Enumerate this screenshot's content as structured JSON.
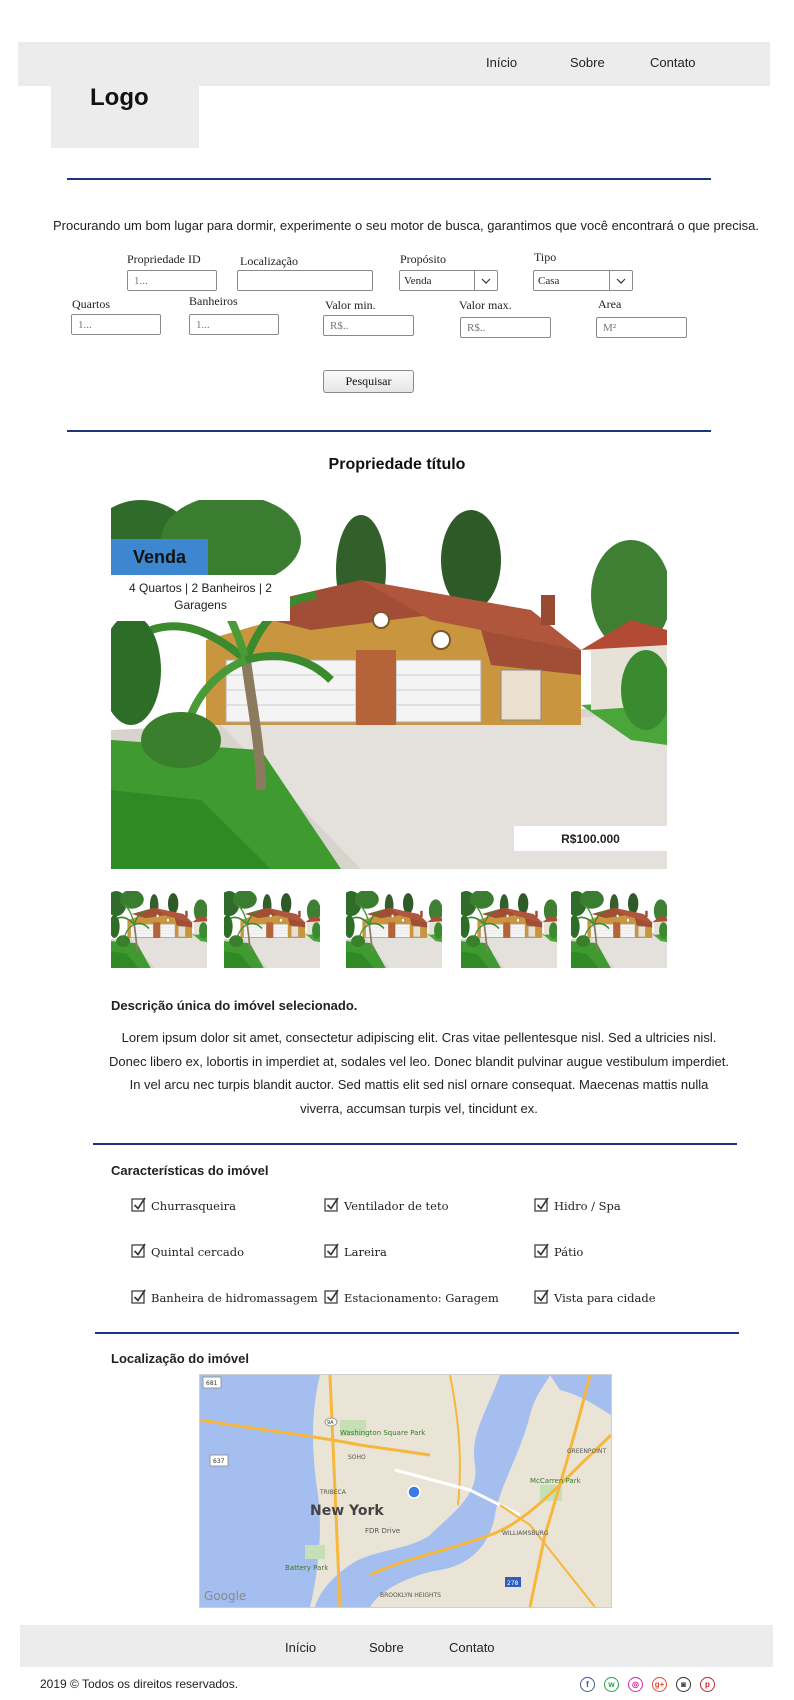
{
  "nav": {
    "items": [
      "Início",
      "Sobre",
      "Contato"
    ]
  },
  "logo": {
    "text": "Logo"
  },
  "search": {
    "intro": "Procurando um bom lugar para dormir, experimente o seu motor de busca, garantimos que você encontrará o que precisa.",
    "fields": {
      "property_id": {
        "label": "Propriedade ID",
        "placeholder": "1..."
      },
      "location": {
        "label": "Localização",
        "placeholder": ""
      },
      "purpose": {
        "label": "Propósito",
        "value": "Venda"
      },
      "type": {
        "label": "Tipo",
        "value": "Casa"
      },
      "rooms": {
        "label": "Quartos",
        "placeholder": "1..."
      },
      "bathrooms": {
        "label": "Banheiros",
        "placeholder": "1..."
      },
      "min_value": {
        "label": "Valor min.",
        "placeholder": "R$.."
      },
      "max_value": {
        "label": "Valor max.",
        "placeholder": "R$.."
      },
      "area": {
        "label": "Area",
        "placeholder": "M²"
      }
    },
    "submit_label": "Pesquisar"
  },
  "property": {
    "title": "Propriedade título",
    "badge": "Venda",
    "summary": "4 Quartos | 2 Banheiros | 2 Garagens",
    "price": "R$100.000",
    "thumbnail_count": 5,
    "description_title": "Descrição única do imóvel selecionado.",
    "description": "Lorem ipsum dolor sit amet, consectetur adipiscing elit. Cras vitae pellentesque nisl. Sed a ultricies nisl. Donec libero ex, lobortis in imperdiet at, sodales vel leo. Donec blandit pulvinar augue vestibulum imperdiet. In vel arcu nec turpis blandit auctor. Sed mattis elit sed nisl ornare consequat. Maecenas mattis nulla viverra, accumsan turpis vel, tincidunt ex."
  },
  "features": {
    "title": "Características do imóvel",
    "items": [
      "Churrasqueira",
      "Ventilador de teto",
      "Hidro / Spa",
      "Quintal cercado",
      "Lareira",
      "Pátio",
      "Banheira de hidromassagem",
      "Estacionamento: Garagem",
      "Vista para cidade"
    ]
  },
  "location": {
    "title": "Localização do imóvel",
    "map_labels": {
      "city": "New York",
      "park": "Washington Square Park",
      "park2": "McCarren Park",
      "soho": "SOHO",
      "tribeca": "TRIBECA",
      "williamsburg": "WILLIAMSBURG",
      "greenpoint": "GREENPOINT",
      "battery": "Battery Park",
      "brooklyn_heights": "BROOKLYN HEIGHTS",
      "fdr": "FDR Drive",
      "google": "Google",
      "road_681": "681",
      "road_637": "637",
      "road_278": "278",
      "road_9a": "9A"
    }
  },
  "footer": {
    "nav": [
      "Início",
      "Sobre",
      "Contato"
    ],
    "copyright": "2019 © Todos os direitos reservados.",
    "social": [
      {
        "name": "facebook-icon",
        "glyph": "f",
        "color": "#3b5998"
      },
      {
        "name": "whatsapp-icon",
        "glyph": "w",
        "color": "#25a244"
      },
      {
        "name": "instagram-icon",
        "glyph": "◎",
        "color": "#d6249f"
      },
      {
        "name": "google-plus-icon",
        "glyph": "g+",
        "color": "#dd4b39"
      },
      {
        "name": "camera-icon",
        "glyph": "◙",
        "color": "#333333"
      },
      {
        "name": "pinterest-icon",
        "glyph": "p",
        "color": "#cb2027"
      }
    ]
  },
  "colors": {
    "accent": "#3d86d0",
    "rule": "#1d3580",
    "bar": "#ececec"
  }
}
